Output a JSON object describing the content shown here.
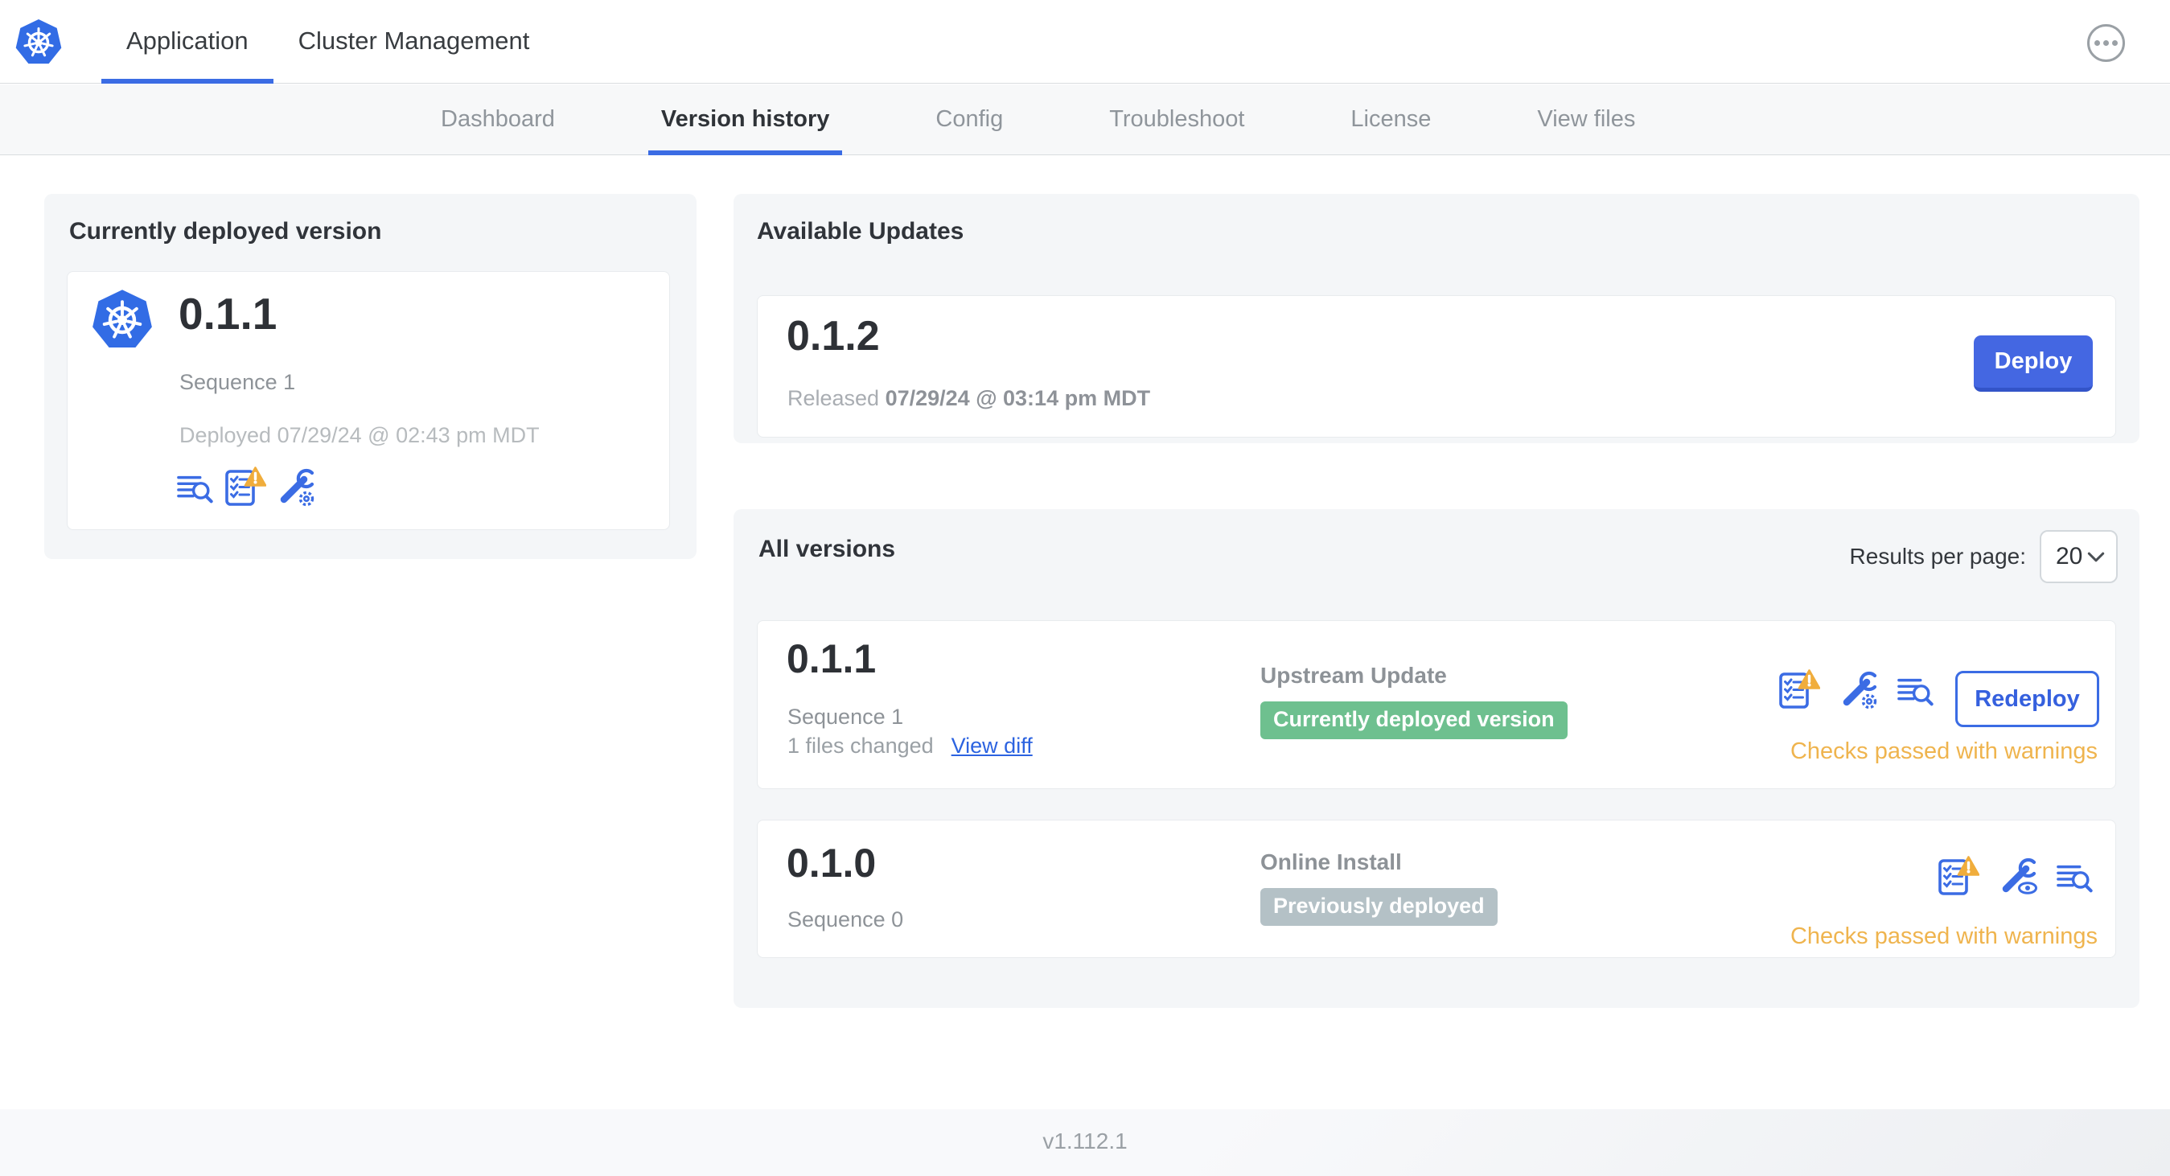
{
  "header": {
    "logo_icon": "kubernetes-logo",
    "tabs": [
      {
        "label": "Application",
        "active": true
      },
      {
        "label": "Cluster Management",
        "active": false
      }
    ],
    "menu_icon": "ellipsis-menu"
  },
  "subnav": {
    "tabs": [
      {
        "label": "Dashboard",
        "active": false
      },
      {
        "label": "Version history",
        "active": true
      },
      {
        "label": "Config",
        "active": false
      },
      {
        "label": "Troubleshoot",
        "active": false
      },
      {
        "label": "License",
        "active": false
      },
      {
        "label": "View files",
        "active": false
      }
    ]
  },
  "deployed_card": {
    "title": "Currently deployed version",
    "version": "0.1.1",
    "sequence": "Sequence 1",
    "deployed_at": "Deployed 07/29/24 @ 02:43 pm MDT",
    "icons": [
      "version-diff-icon",
      "preflight-checks-warning-icon",
      "edit-config-icon"
    ]
  },
  "available_updates": {
    "title": "Available Updates",
    "version": "0.1.2",
    "released_label": "Released",
    "released_at": "07/29/24 @ 03:14 pm MDT",
    "deploy_label": "Deploy"
  },
  "all_versions": {
    "title": "All versions",
    "results_per_page_label": "Results per page:",
    "results_per_page_value": "20",
    "rows": [
      {
        "version": "0.1.1",
        "sequence": "Sequence 1",
        "files_changed": "1 files changed",
        "view_diff_label": "View diff",
        "source": "Upstream Update",
        "badge": {
          "label": "Currently deployed version",
          "color": "green"
        },
        "icons": [
          "preflight-checks-warning-icon",
          "edit-config-icon",
          "version-diff-icon"
        ],
        "action_label": "Redeploy",
        "status": "Checks passed with warnings"
      },
      {
        "version": "0.1.0",
        "sequence": "Sequence 0",
        "source": "Online Install",
        "badge": {
          "label": "Previously deployed",
          "color": "gray"
        },
        "icons": [
          "preflight-checks-warning-icon",
          "view-config-icon",
          "version-diff-icon"
        ],
        "status": "Checks passed with warnings"
      }
    ]
  },
  "footer": {
    "app_version": "v1.112.1"
  },
  "colors": {
    "accent_blue": "#3b6ce4",
    "button_blue": "#4467e2",
    "link_blue": "#2c63e0",
    "kubernetes_blue": "#326ce5",
    "green_badge": "#6ec08f",
    "gray_badge": "#b4c1c6",
    "warning_amber": "#efb44e",
    "panel_gray": "#f4f6f8"
  }
}
